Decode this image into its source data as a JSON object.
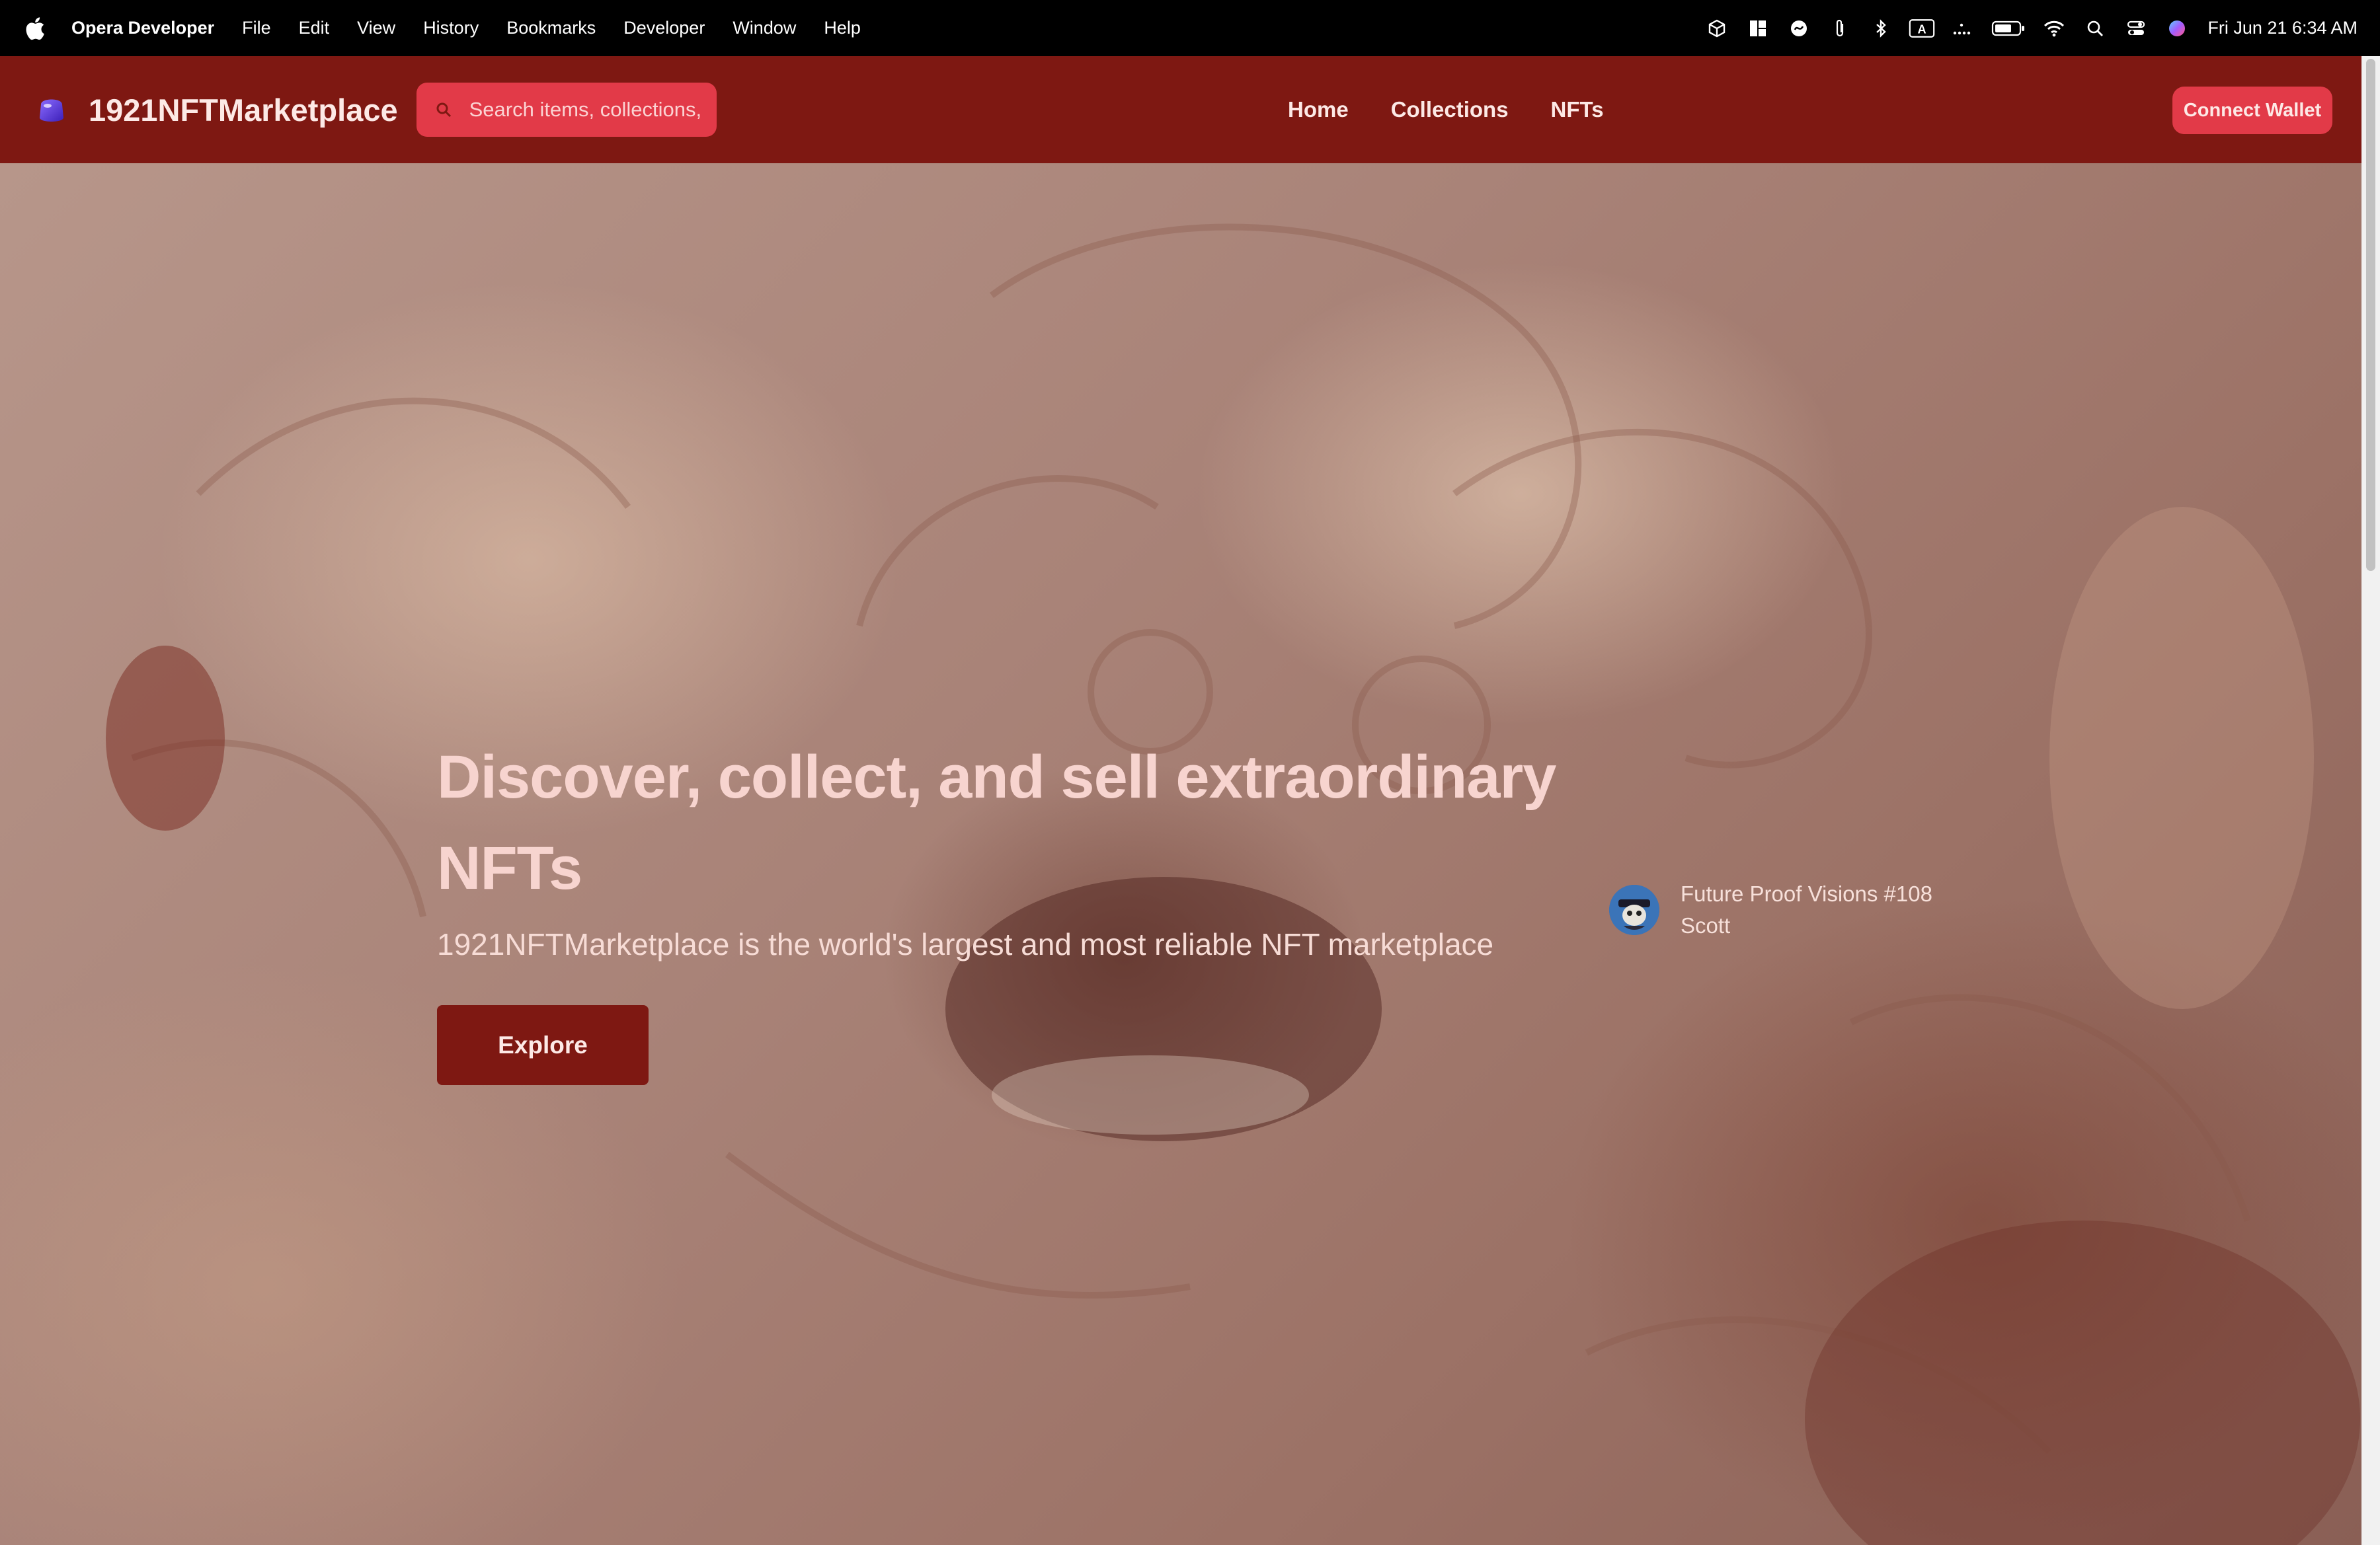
{
  "menubar": {
    "app_name": "Opera Developer",
    "items": [
      "File",
      "Edit",
      "View",
      "History",
      "Bookmarks",
      "Developer",
      "Window",
      "Help"
    ],
    "status_icons": [
      "3d-box-icon",
      "grid-layout-icon",
      "scribble-icon",
      "paperclip-icon",
      "bluetooth-icon",
      "keyboard-input-a-icon",
      "dots-icon",
      "battery-icon",
      "wifi-icon",
      "spotlight-search-icon",
      "control-center-icon",
      "siri-icon"
    ],
    "clock": "Fri Jun 21  6:34 AM",
    "input_badge": "A"
  },
  "header": {
    "brand": "1921NFTMarketplace",
    "search_placeholder": "Search items, collections, and accounts",
    "nav": [
      "Home",
      "Collections",
      "NFTs"
    ],
    "connect_label": "Connect Wallet",
    "background_color": "#7e1812",
    "accent_color": "#e23a48"
  },
  "hero": {
    "title": "Discover, collect, and sell extraordinary NFTs",
    "subtitle": "1921NFTMarketplace is the world's largest and most reliable NFT marketplace",
    "cta_label": "Explore",
    "featured": {
      "title": "Future Proof Visions #108",
      "creator": "Scott"
    }
  }
}
